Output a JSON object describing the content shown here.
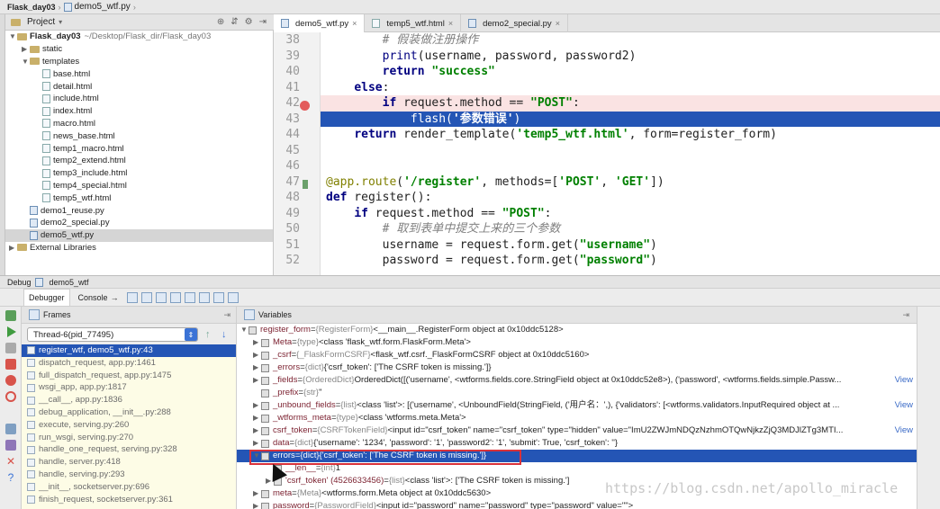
{
  "window": {
    "project": "Flask_day03",
    "file": "demo5_wtf.py"
  },
  "project_panel": {
    "label": "Project",
    "tree": [
      {
        "label": "Flask_day03",
        "path": "~/Desktop/Flask_dir/Flask_day03",
        "kind": "folder",
        "depth": 0,
        "open": true
      },
      {
        "label": "static",
        "kind": "folder",
        "depth": 1,
        "open": false
      },
      {
        "label": "templates",
        "kind": "folder",
        "depth": 1,
        "open": true
      },
      {
        "label": "base.html",
        "kind": "html",
        "depth": 2
      },
      {
        "label": "detail.html",
        "kind": "html",
        "depth": 2
      },
      {
        "label": "include.html",
        "kind": "html",
        "depth": 2
      },
      {
        "label": "index.html",
        "kind": "html",
        "depth": 2
      },
      {
        "label": "macro.html",
        "kind": "html",
        "depth": 2
      },
      {
        "label": "news_base.html",
        "kind": "html",
        "depth": 2
      },
      {
        "label": "temp1_macro.html",
        "kind": "html",
        "depth": 2
      },
      {
        "label": "temp2_extend.html",
        "kind": "html",
        "depth": 2
      },
      {
        "label": "temp3_include.html",
        "kind": "html",
        "depth": 2
      },
      {
        "label": "temp4_special.html",
        "kind": "html",
        "depth": 2
      },
      {
        "label": "temp5_wtf.html",
        "kind": "html",
        "depth": 2
      },
      {
        "label": "demo1_reuse.py",
        "kind": "py",
        "depth": 1
      },
      {
        "label": "demo2_special.py",
        "kind": "py",
        "depth": 1
      },
      {
        "label": "demo5_wtf.py",
        "kind": "py",
        "depth": 1,
        "selected": true
      },
      {
        "label": "External Libraries",
        "kind": "lib",
        "depth": 0
      }
    ]
  },
  "editor": {
    "tabs": [
      {
        "label": "demo5_wtf.py",
        "active": true
      },
      {
        "label": "temp5_wtf.html"
      },
      {
        "label": "demo2_special.py"
      }
    ],
    "lines": [
      {
        "n": "38",
        "html": "        <span class=\"cm\"># 假装做注册操作</span>"
      },
      {
        "n": "39",
        "html": "        <span class=\"fn\">print</span>(username, password, password2)"
      },
      {
        "n": "40",
        "html": "        <span class=\"kw\">return</span> <span class=\"str\">\"success\"</span>"
      },
      {
        "n": "41",
        "html": "    <span class=\"kw\">else</span>:"
      },
      {
        "n": "42",
        "html": "        <span class=\"kw\">if</span> request.method == <span class=\"str\">\"POST\"</span>:",
        "bp": true
      },
      {
        "n": "43",
        "html": "            flash(<span class=\"str\">'参数错误'</span>)",
        "current": true
      },
      {
        "n": "44",
        "html": "    <span class=\"kw\">return</span> render_template(<span class=\"str\">'temp5_wtf.html'</span>, form=register_form)"
      },
      {
        "n": "45",
        "html": ""
      },
      {
        "n": "46",
        "html": ""
      },
      {
        "n": "47",
        "html": "<span class=\"deco\">@app.route</span>(<span class=\"str\">'/register'</span>, methods=[<span class=\"str\">'POST'</span>, <span class=\"str\">'GET'</span>])"
      },
      {
        "n": "48",
        "html": "<span class=\"kw\">def</span> register():"
      },
      {
        "n": "49",
        "html": "    <span class=\"kw\">if</span> request.method == <span class=\"str\">\"POST\"</span>:"
      },
      {
        "n": "50",
        "html": "        <span class=\"cm\"># 取到表单中提交上来的三个参数</span>"
      },
      {
        "n": "51",
        "html": "        username = request.form.get(<span class=\"str\">\"username\"</span>)"
      },
      {
        "n": "52",
        "html": "        password = request.form.get(<span class=\"str\">\"password\"</span>)"
      }
    ]
  },
  "debug": {
    "label": "Debug",
    "config": "demo5_wtf",
    "tabs": [
      {
        "label": "Debugger",
        "active": true
      },
      {
        "label": "Console"
      }
    ],
    "frames_title": "Frames",
    "thread": "Thread-6(pid_77495)",
    "frames": [
      "register_wtf, demo5_wtf.py:43",
      "dispatch_request, app.py:1461",
      "full_dispatch_request, app.py:1475",
      "wsgi_app, app.py:1817",
      "__call__, app.py:1836",
      "debug_application, __init__.py:288",
      "execute, serving.py:260",
      "run_wsgi, serving.py:270",
      "handle_one_request, serving.py:328",
      "handle, server.py:418",
      "handle, serving.py:293",
      "__init__, socketserver.py:696",
      "finish_request, socketserver.py:361"
    ],
    "variables_title": "Variables",
    "variables": [
      {
        "indent": 0,
        "arrow": "▼",
        "name": "register_form",
        "type": "{RegisterForm}",
        "value": "<__main__.RegisterForm object at 0x10ddc5128>"
      },
      {
        "indent": 1,
        "arrow": "▶",
        "name": "Meta",
        "type": "{type}",
        "value": "<class 'flask_wtf.form.FlaskForm.Meta'>"
      },
      {
        "indent": 1,
        "arrow": "▶",
        "name": "_csrf",
        "type": "{_FlaskFormCSRF}",
        "value": "<flask_wtf.csrf._FlaskFormCSRF object at 0x10ddc5160>"
      },
      {
        "indent": 1,
        "arrow": "▶",
        "name": "_errors",
        "type": "{dict}",
        "value": "{'csrf_token': ['The CSRF token is missing.']}"
      },
      {
        "indent": 1,
        "arrow": "▶",
        "name": "_fields",
        "type": "{OrderedDict}",
        "value": "OrderedDict([('username', <wtforms.fields.core.StringField object at 0x10ddc52e8>), ('password', <wtforms.fields.simple.Passw...",
        "view": "View"
      },
      {
        "indent": 1,
        "arrow": "",
        "name": "_prefix",
        "type": "{str}",
        "value": "''"
      },
      {
        "indent": 1,
        "arrow": "▶",
        "name": "_unbound_fields",
        "type": "{list}",
        "value": "<class 'list'>: [('username', <UnboundField(StringField, ('用户名：',), {'validators': [<wtforms.validators.InputRequired object at ...",
        "view": "View"
      },
      {
        "indent": 1,
        "arrow": "▶",
        "name": "_wtforms_meta",
        "type": "{type}",
        "value": "<class 'wtforms.meta.Meta'>"
      },
      {
        "indent": 1,
        "arrow": "▶",
        "name": "csrf_token",
        "type": "{CSRFTokenField}",
        "value": "<input id=\"csrf_token\" name=\"csrf_token\" type=\"hidden\" value=\"ImU2ZWJmNDQzNzhmOTQwNjkzZjQ3MDJlZTg3MTI...",
        "view": "View"
      },
      {
        "indent": 1,
        "arrow": "▶",
        "name": "data",
        "type": "{dict}",
        "value": "{'username': '1234', 'password': '1', 'password2': '1', 'submit': True, 'csrf_token': ''}"
      },
      {
        "indent": 1,
        "arrow": "▼",
        "name": "errors",
        "type": "{dict}",
        "value": "{'csrf_token': ['The CSRF token is missing.']}",
        "selected": true
      },
      {
        "indent": 2,
        "arrow": "",
        "name": "__len__",
        "type": "{int}",
        "value": "1"
      },
      {
        "indent": 2,
        "arrow": "▶",
        "name": "'csrf_token' (4526633456)",
        "type": "{list}",
        "value": "<class 'list'>: ['The CSRF token is missing.']"
      },
      {
        "indent": 1,
        "arrow": "▶",
        "name": "meta",
        "type": "{Meta}",
        "value": "<wtforms.form.Meta object at 0x10ddc5630>"
      },
      {
        "indent": 1,
        "arrow": "▶",
        "name": "password",
        "type": "{PasswordField}",
        "value": "<input id=\"password\" name=\"password\" type=\"password\" value=\"\">"
      }
    ]
  },
  "watermark": "https://blog.csdn.net/apollo_miracle",
  "colors": {
    "selection": "#2455b5",
    "breakpoint": "#e35b5b",
    "highlight_box": "#d9323a"
  }
}
